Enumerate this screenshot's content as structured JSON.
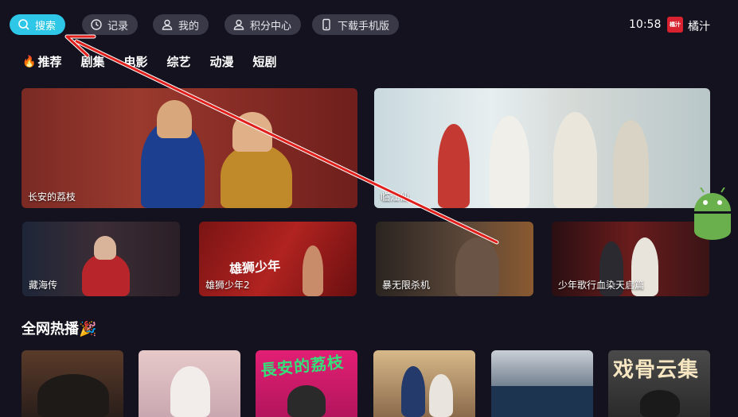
{
  "topbar": {
    "search_label": "搜索",
    "history_label": "记录",
    "mine_label": "我的",
    "points_label": "积分中心",
    "download_label": "下载手机版",
    "clock": "10:58",
    "brand_logo_text": "橘汁",
    "brand_name": "橘汁"
  },
  "categories": [
    "推荐",
    "剧集",
    "电影",
    "综艺",
    "动漫",
    "短剧"
  ],
  "banners": [
    {
      "title": "长安的荔枝"
    },
    {
      "title": "临江仙"
    }
  ],
  "small_cards": [
    {
      "title": "藏海传"
    },
    {
      "title": "雄狮少年2",
      "art_text": "雄狮少年"
    },
    {
      "title": "暴无限杀机"
    },
    {
      "title": "少年歌行血染天启篇"
    }
  ],
  "section": {
    "title": "全网热播🎉"
  },
  "posters": [
    {
      "art_text": ""
    },
    {
      "art_text": ""
    },
    {
      "art_text": "長安的荔枝"
    },
    {
      "art_text": ""
    },
    {
      "art_text": ""
    },
    {
      "art_text": "戏骨云集"
    }
  ],
  "colors": {
    "background": "#14121f",
    "pill": "#3a3947",
    "pill_active": "#2ec7e8",
    "annotation_arrow": "#e0201c",
    "android": "#6ab04c"
  }
}
